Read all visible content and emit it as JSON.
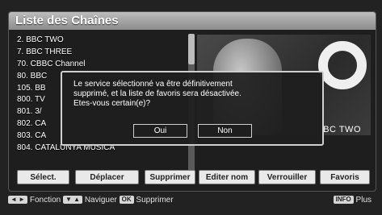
{
  "header": {
    "title": "Liste des Chaînes"
  },
  "channels": [
    "2. BBC TWO",
    "7. BBC THREE",
    "70. CBBC Channel",
    "80. BBC",
    "105. BB",
    "800. TV",
    "801. 3/",
    "802. CA",
    "803. CA",
    "804. CATALUNYA MÚSICA"
  ],
  "preview": {
    "channel_label": "BC TWO"
  },
  "dialog": {
    "message_lines": [
      "Le service sélectionné va être définitivement",
      "supprimé, et la liste de favoris sera désactivée.",
      "Etes-vous certain(e)?"
    ],
    "yes": "Oui",
    "no": "Non"
  },
  "toolbar": {
    "select": "Sélect.",
    "move": "Déplacer",
    "delete": "Supprimer",
    "edit_name": "Editer nom",
    "lock": "Verrouiller",
    "favorites": "Favoris"
  },
  "hints": {
    "lr_key": "◄ ►",
    "function": "Fonction",
    "ud_key": "▼ ▲",
    "navigate": "Naviguer",
    "ok_key": "OK",
    "delete": "Supprimer",
    "info_key": "INFO",
    "more": "Plus"
  }
}
